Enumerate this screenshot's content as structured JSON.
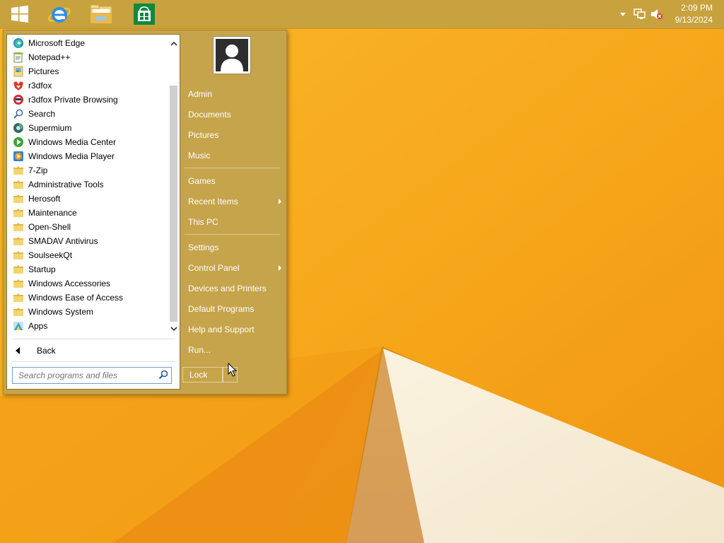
{
  "taskbar": {
    "start_icon": "windows-logo-icon",
    "pinned": [
      {
        "name": "internet-explorer-icon"
      },
      {
        "name": "file-explorer-icon"
      },
      {
        "name": "store-icon"
      }
    ],
    "tray": {
      "overflow_icon": "chevron-up-icon",
      "network_icon": "network-icon",
      "volume_icon": "volume-muted-icon"
    },
    "clock": {
      "time": "2:09 PM",
      "date": "9/13/2024"
    }
  },
  "start_menu": {
    "programs": [
      {
        "label": "Microsoft Edge",
        "icon": "edge-icon"
      },
      {
        "label": "Notepad++",
        "icon": "notepad-plus-plus-icon"
      },
      {
        "label": "Pictures",
        "icon": "pictures-icon"
      },
      {
        "label": "r3dfox",
        "icon": "r3dfox-icon"
      },
      {
        "label": "r3dfox Private Browsing",
        "icon": "r3dfox-private-icon"
      },
      {
        "label": "Search",
        "icon": "search-icon"
      },
      {
        "label": "Supermium",
        "icon": "supermium-icon"
      },
      {
        "label": "Windows Media Center",
        "icon": "media-center-icon"
      },
      {
        "label": "Windows Media Player",
        "icon": "media-player-icon"
      },
      {
        "label": "7-Zip",
        "icon": "folder-icon"
      },
      {
        "label": "Administrative Tools",
        "icon": "folder-icon"
      },
      {
        "label": "Herosoft",
        "icon": "folder-icon"
      },
      {
        "label": "Maintenance",
        "icon": "folder-icon"
      },
      {
        "label": "Open-Shell",
        "icon": "folder-icon"
      },
      {
        "label": "SMADAV Antivirus",
        "icon": "folder-icon"
      },
      {
        "label": "SoulseekQt",
        "icon": "folder-icon"
      },
      {
        "label": "Startup",
        "icon": "folder-icon"
      },
      {
        "label": "Windows Accessories",
        "icon": "folder-icon"
      },
      {
        "label": "Windows Ease of Access",
        "icon": "folder-icon"
      },
      {
        "label": "Windows System",
        "icon": "folder-icon"
      },
      {
        "label": "Apps",
        "icon": "apps-icon"
      }
    ],
    "back_label": "Back",
    "search_placeholder": "Search programs and files",
    "right_items": [
      {
        "label": "Admin",
        "has_submenu": false
      },
      {
        "label": "Documents",
        "has_submenu": false
      },
      {
        "label": "Pictures",
        "has_submenu": false
      },
      {
        "label": "Music",
        "has_submenu": false
      },
      {
        "label": "Games",
        "has_submenu": false
      },
      {
        "label": "Recent Items",
        "has_submenu": true
      },
      {
        "label": "This PC",
        "has_submenu": false
      },
      {
        "label": "Settings",
        "has_submenu": false
      },
      {
        "label": "Control Panel",
        "has_submenu": true
      },
      {
        "label": "Devices and Printers",
        "has_submenu": false
      },
      {
        "label": "Default Programs",
        "has_submenu": false
      },
      {
        "label": "Help and Support",
        "has_submenu": false
      },
      {
        "label": "Run...",
        "has_submenu": false
      }
    ],
    "lock_label": "Lock"
  },
  "colors": {
    "taskbar": "#c7a23e",
    "menu_bg": "#c5a44b",
    "wallpaper": "#f5a51a"
  }
}
